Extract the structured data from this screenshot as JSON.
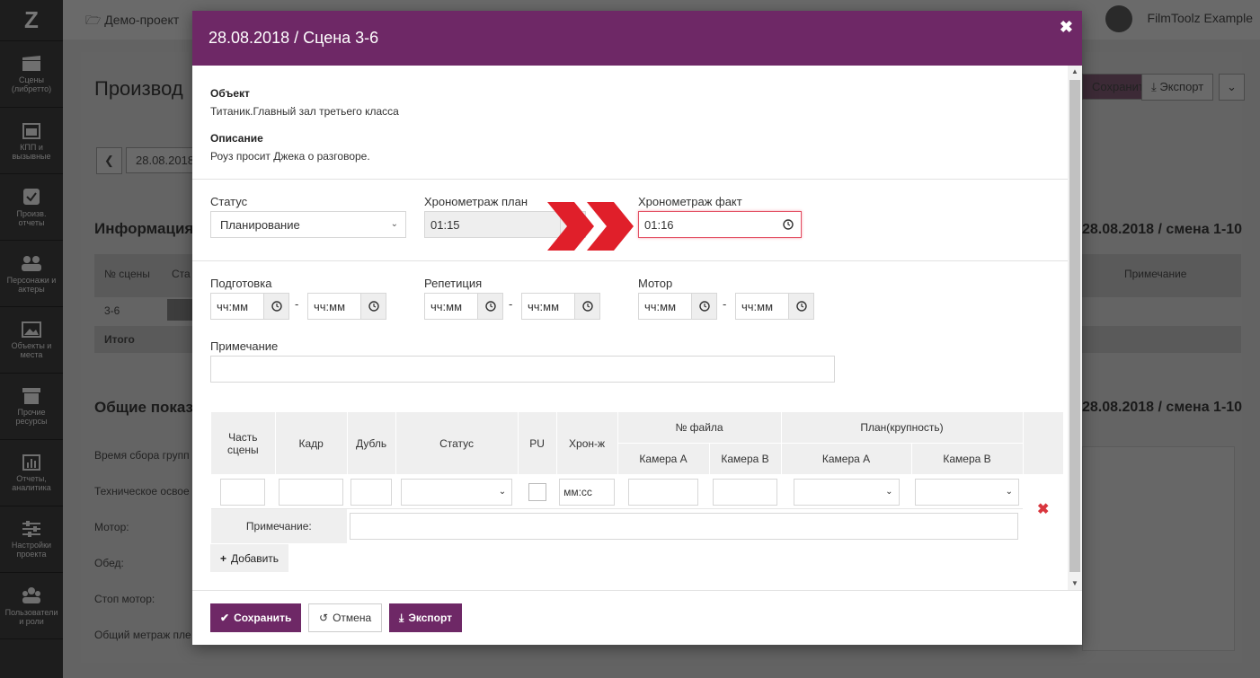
{
  "sidebar": {
    "logo": "Z",
    "items": [
      {
        "label": "Сцены (либретто)",
        "icon": "clapperboard-icon"
      },
      {
        "label": "КПП и вызывные",
        "icon": "calendar-icon"
      },
      {
        "label": "Произв. отчеты",
        "icon": "checkbox-icon"
      },
      {
        "label": "Персонажи и актеры",
        "icon": "people-icon"
      },
      {
        "label": "Объекты и места",
        "icon": "image-icon"
      },
      {
        "label": "Прочие ресурсы",
        "icon": "box-icon"
      },
      {
        "label": "Отчеты, аналитика",
        "icon": "bar-chart-icon"
      },
      {
        "label": "Настройки проекта",
        "icon": "sliders-icon"
      },
      {
        "label": "Пользователи и роли",
        "icon": "users-icon"
      }
    ]
  },
  "background": {
    "project": "Демо-проект",
    "user": "FilmToolz Example",
    "page_title": "Производ",
    "save_label": "Сохранить",
    "export_label": "Экспорт",
    "date_value": "28.08.2018",
    "info_title": "Информация",
    "info_right": "28.08.2018 / смена 1-10",
    "col_scene_no": "№ сцены",
    "col_status_short": "Ста",
    "col_note": "Примечание",
    "row_scene": "3-6",
    "row_total": "Итого",
    "general_title": "Общие показ",
    "general_right": "28.08.2018 / смена 1-10",
    "stats": [
      "Время сбора групп",
      "Техническое освое",
      "Мотор:",
      "Обед:",
      "Стоп мотор:",
      "Общий метраж пле"
    ]
  },
  "modal": {
    "title": "28.08.2018 / Сцена 3-6",
    "object_label": "Объект",
    "object_value": "Титаник.Главный зал третьего класса",
    "description_label": "Описание",
    "description_value": "Роуз просит Джека о разговоре.",
    "status_label": "Статус",
    "status_value": "Планирование",
    "timing_plan_label": "Хронометраж план",
    "timing_plan_value": "01:15",
    "timing_fact_label": "Хронометраж факт",
    "timing_fact_value": "01:16",
    "prep_label": "Подготовка",
    "rehearsal_label": "Репетиция",
    "motor_label": "Мотор",
    "time_placeholder": "чч:мм",
    "range_dash": "-",
    "note_label": "Примечание",
    "table": {
      "h_part": "Часть сцены",
      "h_frame": "Кадр",
      "h_take": "Дубль",
      "h_status": "Статус",
      "h_pu": "PU",
      "h_timing": "Хрон-ж",
      "h_file_no": "№ файла",
      "h_plan": "План(крупность)",
      "h_cam_a": "Камера А",
      "h_cam_b": "Камера B",
      "timing_placeholder": "мм:сс",
      "row_note_label": "Примечание:"
    },
    "add_label": "Добавить",
    "save_label": "Сохранить",
    "cancel_label": "Отмена",
    "export_label": "Экспорт"
  },
  "colors": {
    "brand": "#6e2866",
    "arrow": "#e01f2a",
    "error": "#e34f63",
    "delete": "#d9363e"
  }
}
